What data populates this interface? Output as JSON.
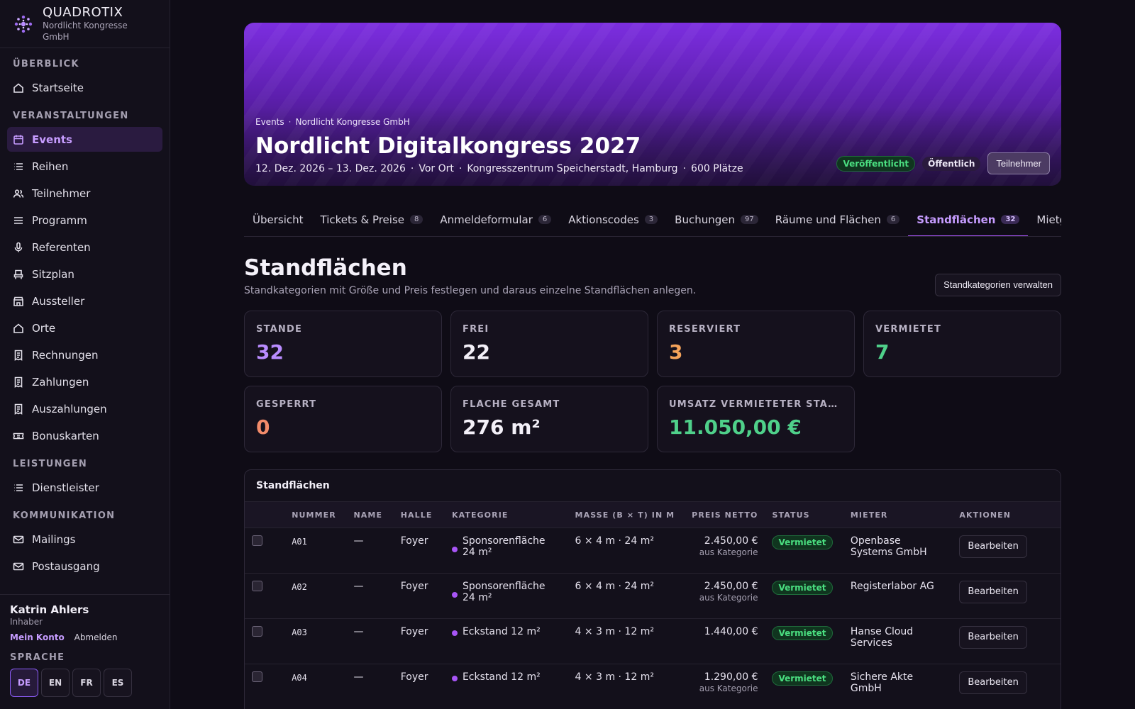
{
  "brand": {
    "name": "QUADROTIX",
    "org": "Nordlicht Kongresse GmbH"
  },
  "sidebar": {
    "sections": [
      {
        "title": "ÜBERBLICK",
        "items": [
          {
            "label": "Startseite",
            "icon": "home-icon"
          }
        ]
      },
      {
        "title": "VERANSTALTUNGEN",
        "items": [
          {
            "label": "Events",
            "icon": "calendar-icon",
            "active": true
          },
          {
            "label": "Reihen",
            "icon": "list-icon"
          },
          {
            "label": "Teilnehmer",
            "icon": "users-icon"
          },
          {
            "label": "Programm",
            "icon": "lines-icon"
          },
          {
            "label": "Referenten",
            "icon": "microphone-icon"
          },
          {
            "label": "Sitzplan",
            "icon": "seat-icon"
          },
          {
            "label": "Aussteller",
            "icon": "store-icon"
          },
          {
            "label": "Orte",
            "icon": "home-icon"
          },
          {
            "label": "Rechnungen",
            "icon": "receipt-icon"
          },
          {
            "label": "Zahlungen",
            "icon": "receipt-icon"
          },
          {
            "label": "Auszahlungen",
            "icon": "receipt-icon"
          },
          {
            "label": "Bonuskarten",
            "icon": "ticket-icon"
          }
        ]
      },
      {
        "title": "LEISTUNGEN",
        "items": [
          {
            "label": "Dienstleister",
            "icon": "list-icon"
          }
        ]
      },
      {
        "title": "KOMMUNIKATION",
        "items": [
          {
            "label": "Mailings",
            "icon": "mail-icon"
          },
          {
            "label": "Postausgang",
            "icon": "mail-icon"
          }
        ]
      }
    ]
  },
  "user": {
    "name": "Katrin Ahlers",
    "role": "Inhaber",
    "account_label": "Mein Konto",
    "logout_label": "Abmelden",
    "language_title": "SPRACHE",
    "languages": [
      "DE",
      "EN",
      "FR",
      "ES"
    ],
    "active_language": "DE"
  },
  "hero": {
    "breadcrumb": [
      "Events",
      "Nordlicht Kongresse GmbH"
    ],
    "title": "Nordlicht Digitalkongress 2027",
    "meta": [
      "12. Dez. 2026 – 13. Dez. 2026",
      "Vor Ort",
      "Kongresszentrum Speicherstadt, Hamburg",
      "600 Plätze"
    ],
    "status_badge": "Veröffentlicht",
    "visibility_badge": "Öffentlich",
    "participants_button": "Teilnehmer"
  },
  "tabs": [
    {
      "label": "Übersicht"
    },
    {
      "label": "Tickets & Preise",
      "count": "8"
    },
    {
      "label": "Anmeldeformular",
      "count": "6"
    },
    {
      "label": "Aktionscodes",
      "count": "3"
    },
    {
      "label": "Buchungen",
      "count": "97"
    },
    {
      "label": "Räume und Flächen",
      "count": "6"
    },
    {
      "label": "Standflächen",
      "count": "32",
      "active": true
    },
    {
      "label": "Mietgegenstände"
    }
  ],
  "page": {
    "title": "Standflächen",
    "description": "Standkategorien mit Größe und Preis festlegen und daraus einzelne Standflächen anlegen.",
    "manage_button": "Standkategorien verwalten"
  },
  "stats": [
    {
      "label": "STÄNDE",
      "value": "32",
      "color": "#b98cff"
    },
    {
      "label": "FREI",
      "value": "22",
      "color": "#f3f0f8"
    },
    {
      "label": "RESERVIERT",
      "value": "3",
      "color": "#f5a35a"
    },
    {
      "label": "VERMIETET",
      "value": "7",
      "color": "#4fd08a"
    },
    {
      "label": "GESPERRT",
      "value": "0",
      "color": "#f28b6a"
    },
    {
      "label": "FLÄCHE GESAMT",
      "value": "276 m²",
      "color": "#f3f0f8"
    },
    {
      "label": "UMSATZ VERMIETETER STÄNDE",
      "value": "11.050,00 €",
      "color": "#4fd08a"
    }
  ],
  "table": {
    "title": "Standflächen",
    "columns": [
      "NUMMER",
      "NAME",
      "HALLE",
      "KATEGORIE",
      "MASSE (B × T) IN M",
      "PREIS NETTO",
      "STATUS",
      "MIETER",
      "AKTIONEN"
    ],
    "edit_label": "Bearbeiten",
    "rows": [
      {
        "number": "A01",
        "name": "—",
        "hall": "Foyer",
        "category": "Sponsorenfläche 24 m²",
        "dims": "6 × 4 m · 24 m²",
        "price": "2.450,00 €",
        "price_note": "aus Kategorie",
        "status": "Vermietet",
        "tenant": "Openbase Systems GmbH"
      },
      {
        "number": "A02",
        "name": "—",
        "hall": "Foyer",
        "category": "Sponsorenfläche 24 m²",
        "dims": "6 × 4 m · 24 m²",
        "price": "2.450,00 €",
        "price_note": "aus Kategorie",
        "status": "Vermietet",
        "tenant": "Registerlabor AG"
      },
      {
        "number": "A03",
        "name": "—",
        "hall": "Foyer",
        "category": "Eckstand 12 m²",
        "dims": "4 × 3 m · 12 m²",
        "price": "1.440,00 €",
        "price_note": "",
        "status": "Vermietet",
        "tenant": "Hanse Cloud Services"
      },
      {
        "number": "A04",
        "name": "—",
        "hall": "Foyer",
        "category": "Eckstand 12 m²",
        "dims": "4 × 3 m · 12 m²",
        "price": "1.290,00 €",
        "price_note": "aus Kategorie",
        "status": "Vermietet",
        "tenant": "Sichere Akte GmbH"
      }
    ]
  }
}
